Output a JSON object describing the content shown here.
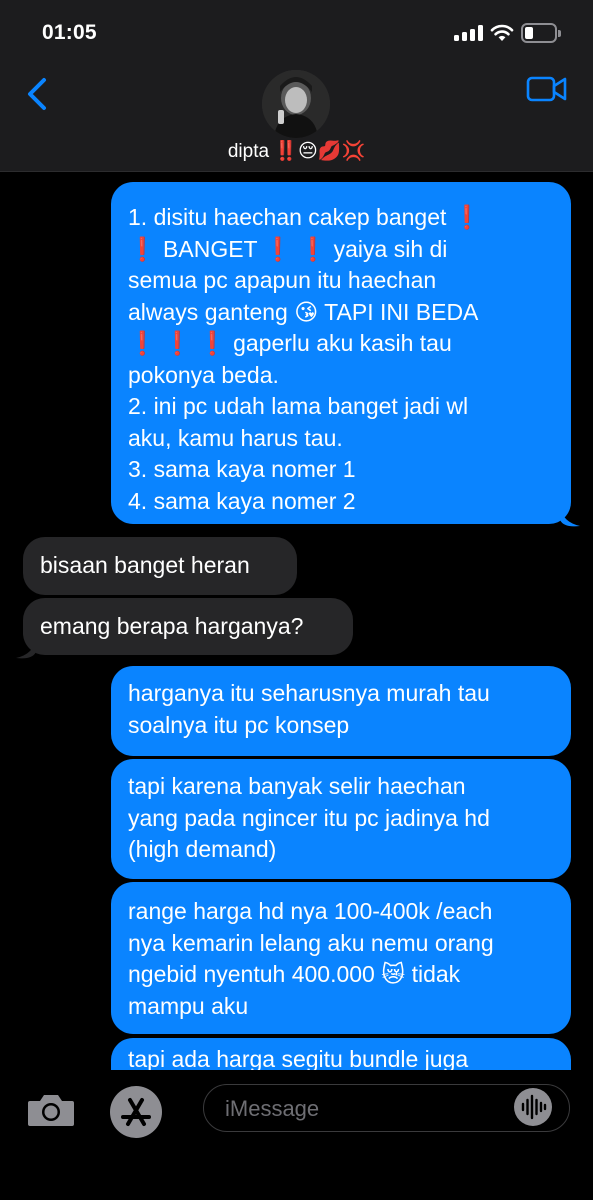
{
  "status": {
    "time": "01:05",
    "battery_level": 0.3
  },
  "header": {
    "contact_name": "dipta ‼️😔💋💢"
  },
  "messages": [
    {
      "direction": "sent",
      "text": "1. disitu haechan cakep banget ❗\n❗ BANGET ❗ ❗ yaiya sih di\nsemua pc apapun itu haechan\nalways ganteng 😘 TAPI INI BEDA\n❗ ❗ ❗ gaperlu aku kasih tau\npokonya beda.\n2. ini pc udah lama banget jadi wl\naku, kamu harus tau.\n3. sama kaya nomer 1\n4. sama kaya nomer 2"
    },
    {
      "direction": "received",
      "text": "bisaan banget heran"
    },
    {
      "direction": "received",
      "text": "emang berapa harganya?"
    },
    {
      "direction": "sent",
      "text": "harganya itu seharusnya murah tau\nsoalnya itu pc konsep"
    },
    {
      "direction": "sent",
      "text": "tapi karena banyak selir haechan\nyang pada ngincer itu pc jadinya hd\n(high demand)"
    },
    {
      "direction": "sent",
      "text": "range harga hd nya 100-400k /each\nnya kemarin lelang aku nemu orang\nngebid nyentuh 400.000 😿 tidak\nmampu aku"
    },
    {
      "direction": "sent",
      "text": "tapi ada harga segitu bundle juga"
    }
  ],
  "compose": {
    "placeholder": "iMessage"
  },
  "colors": {
    "sent_bubble": "#0a84ff",
    "received_bubble": "#262628",
    "accent": "#0a84ff"
  }
}
